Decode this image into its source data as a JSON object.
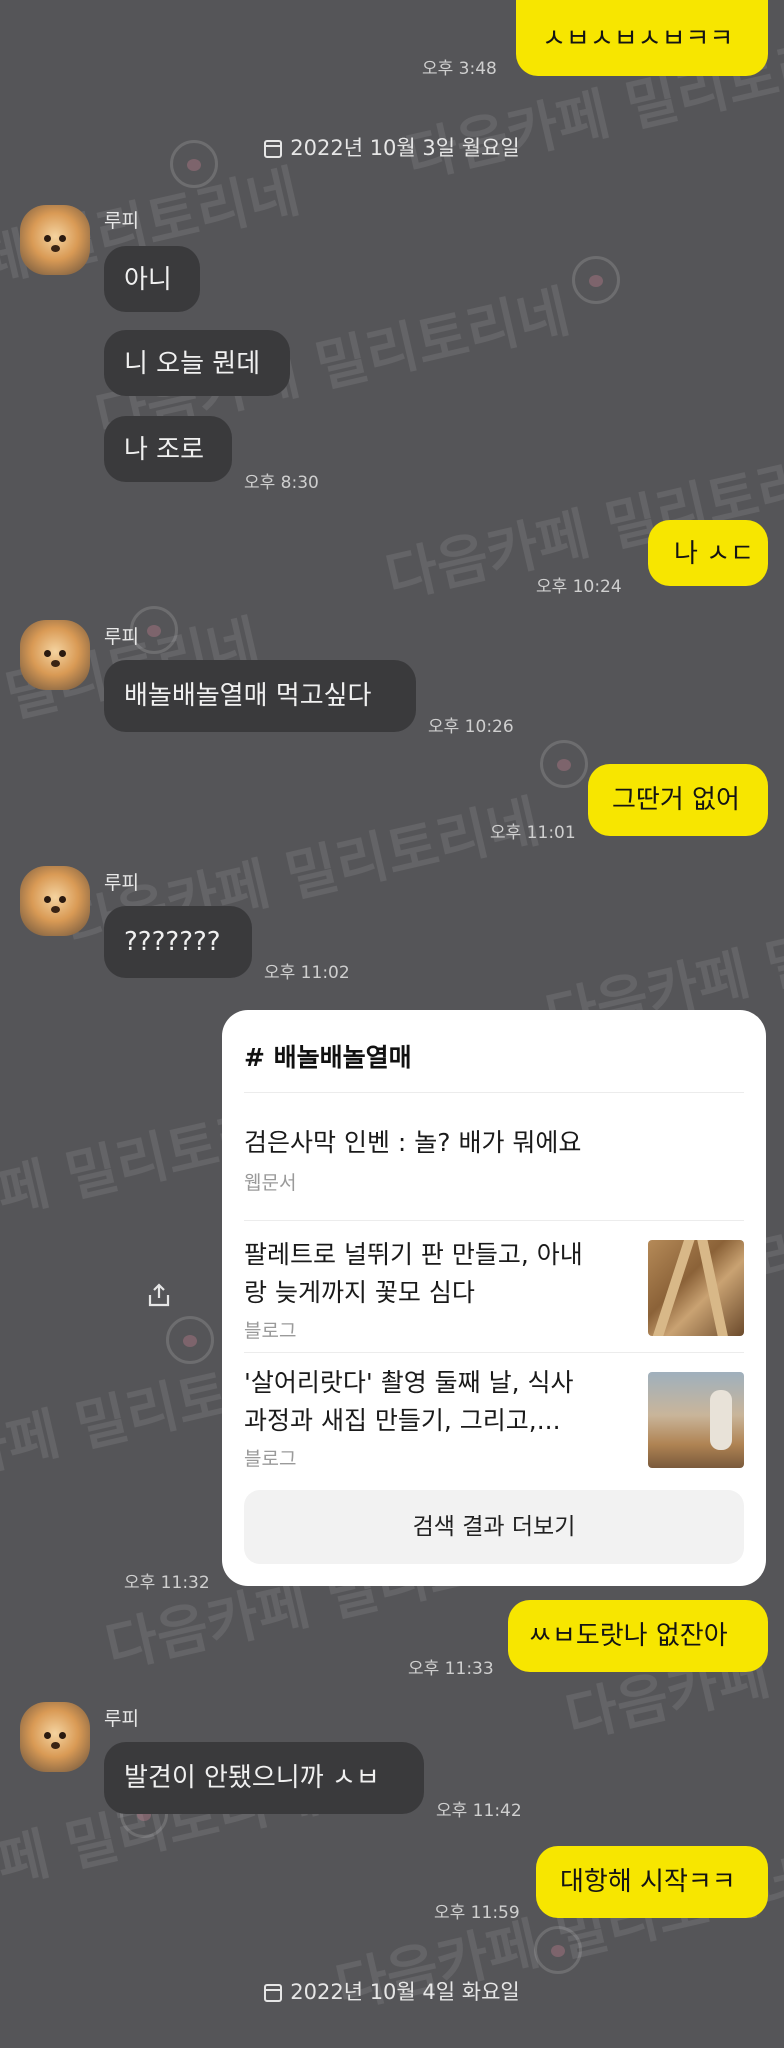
{
  "messages": [
    {
      "text": "ㅅㅂㅅㅂㅅㅂㅋㅋ",
      "time": "오후 3:48"
    },
    {
      "text": "아니"
    },
    {
      "text": "니 오늘 뭔데"
    },
    {
      "text": "나 조로",
      "time": "오후 8:30"
    },
    {
      "text": "나 ㅅㄷ",
      "time": "오후 10:24"
    },
    {
      "text": "배놀배놀열매 먹고싶다",
      "time": "오후 10:26"
    },
    {
      "text": "그딴거 없어",
      "time": "오후 11:01"
    },
    {
      "text": "???????",
      "time": "오후 11:02"
    },
    {
      "text": "ㅆㅂ도랏나 없잔아",
      "time": "오후 11:33"
    },
    {
      "text": "발견이 안됐으니까 ㅅㅂ",
      "time": "오후 11:42"
    },
    {
      "text": "대항해 시작ㅋㅋ",
      "time": "오후 11:59"
    }
  ],
  "sender_name": "루피",
  "dates": [
    "2022년 10월 3일 월요일",
    "2022년 10월 4일 화요일"
  ],
  "search_card": {
    "hashtag": "# 배놀배놀열매",
    "results": [
      {
        "title_line1": "검은사막 인벤 : 놀? 배가 뭐에요",
        "source": "웹문서"
      },
      {
        "title_line1": "팔레트로 널뛰기 판 만들고, 아내",
        "title_line2": "랑 늦게까지 꽃모 심다",
        "source": "블로그"
      },
      {
        "title_line1": "'살어리랏다' 촬영 둘째 날, 식사",
        "title_line2": "과정과 새집 만들기, 그리고,...",
        "source": "블로그"
      }
    ],
    "more_label": "검색 결과 더보기",
    "time": "오후 11:32"
  },
  "watermark": "다음카페 밀리토리네",
  "colors": {
    "background": "#555558",
    "my_bubble": "#F7E600",
    "other_bubble": "#3a3a3c"
  }
}
